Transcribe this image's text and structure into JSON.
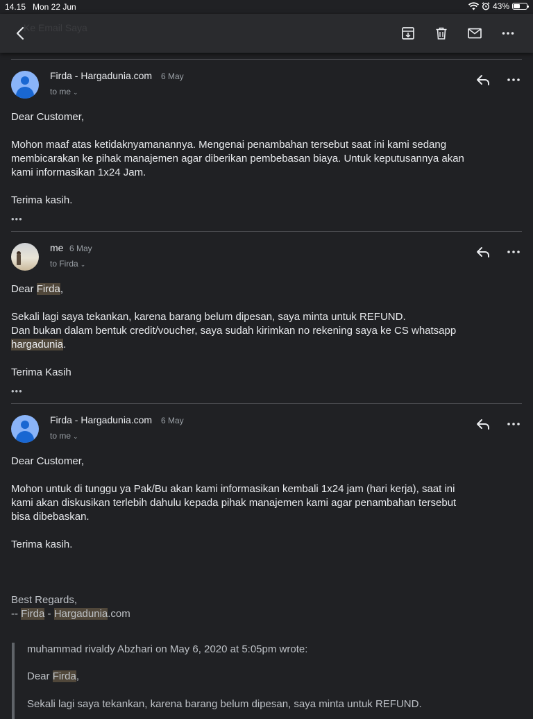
{
  "status_bar": {
    "time": "14.15",
    "date": "Mon 22 Jun",
    "battery": "43%"
  },
  "toolbar": {
    "ghost_title": "Ke Email Saya"
  },
  "messages": [
    {
      "sender": "Firda - Hargadunia.com",
      "date": "6 May",
      "recipient": "to me",
      "greeting": "Dear Customer,",
      "body": [
        "Mohon maaf atas ketidaknyamanannya. Mengenai penambahan tersebut saat ini kami sedang",
        "membicarakan ke pihak manajemen agar diberikan pembebasan biaya. Untuk keputusannya akan",
        "kami informasikan 1x24 Jam."
      ],
      "closing": "Terima kasih."
    },
    {
      "sender": "me",
      "date": "6 May",
      "recipient": "to Firda",
      "greeting_pre": "Dear ",
      "greeting_name": "Firda",
      "greeting_post": ",",
      "body": [
        "Sekali lagi saya tekankan, karena barang belum dipesan, saya minta untuk REFUND.",
        "Dan bukan dalam bentuk credit/voucher, saya sudah kirimkan no rekening saya ke CS whatsapp"
      ],
      "body_hl": "hargadunia",
      "body_hl_post": ".",
      "closing": "Terima Kasih"
    },
    {
      "sender": "Firda - Hargadunia.com",
      "date": "6 May",
      "recipient": "to me",
      "greeting": "Dear Customer,",
      "body": [
        "Mohon untuk di tunggu ya Pak/Bu akan kami informasikan kembali 1x24 jam (hari kerja), saat ini",
        "kami akan diskusikan terlebih dahulu kepada pihak manajemen kami agar penambahan tersebut",
        "bisa dibebaskan."
      ],
      "closing": "Terima kasih.",
      "signature": {
        "line1": "Best Regards,",
        "prefix": "-- ",
        "name1": "Firda",
        "sep": " - ",
        "name2": "Hargadunia",
        "suffix": ".com"
      },
      "quote": {
        "header": "muhammad rivaldy Abzhari on May 6, 2020 at 5:05pm wrote:",
        "greeting_pre": "Dear ",
        "greeting_name": "Firda",
        "greeting_post": ",",
        "line": "Sekali lagi saya tekankan, karena barang belum dipesan, saya minta untuk REFUND."
      }
    }
  ],
  "more_dots": "•••"
}
